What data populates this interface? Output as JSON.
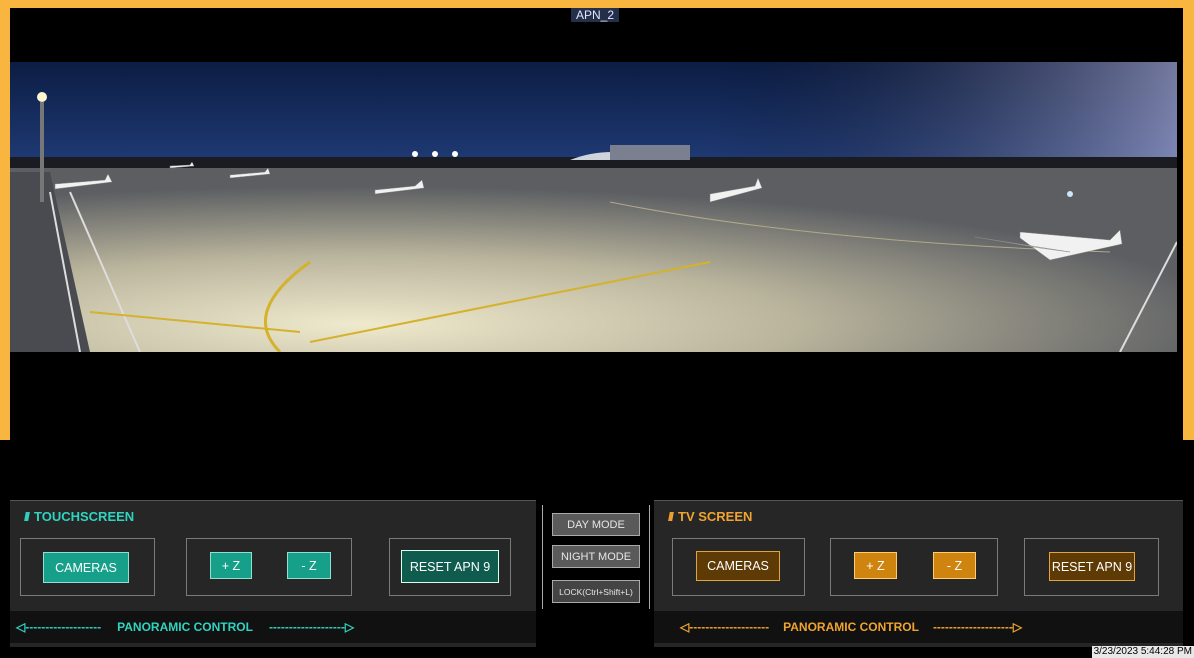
{
  "camera_title": "APN_2",
  "touchscreen": {
    "title": "TOUCHSCREEN",
    "cameras_label": "CAMERAS",
    "zoom_in_label": "+ Z",
    "zoom_out_label": "- Z",
    "reset_label": "RESET APN 9",
    "pan_label": "PANORAMIC CONTROL",
    "pan_left": "◁-------------------",
    "pan_right": "-------------------▷"
  },
  "modes": {
    "day": "DAY MODE",
    "night": "NIGHT MODE",
    "lock": "LOCK(Ctrl+Shift+L)"
  },
  "tv_screen": {
    "title": "TV SCREEN",
    "cameras_label": "CAMERAS",
    "zoom_in_label": "+ Z",
    "zoom_out_label": "- Z",
    "reset_label": "RESET APN 9",
    "pan_label": "PANORAMIC CONTROL",
    "pan_left": "◁--------------------",
    "pan_right": "--------------------▷"
  },
  "timestamp": "3/23/2023 5:44:28 PM",
  "colors": {
    "frame": "#f8b640",
    "touchscreen_accent": "#2fd4c1",
    "tv_accent": "#f0a430"
  }
}
